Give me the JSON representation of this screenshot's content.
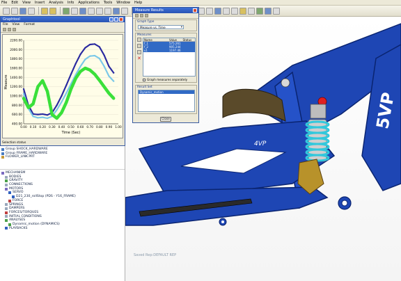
{
  "menubar": {
    "items": [
      "File",
      "Edit",
      "View",
      "Insert",
      "Analysis",
      "Info",
      "Applications",
      "Tools",
      "Window",
      "Help"
    ]
  },
  "graph_window": {
    "title": "Graphtool",
    "menu": [
      "File",
      "View",
      "Format"
    ],
    "status": "Selection status"
  },
  "chart_data": {
    "type": "line",
    "xlabel": "Time (Sec)",
    "ylabel": "Measure",
    "x_ticks": [
      "0.00",
      "0.10",
      "0.20",
      "0.30",
      "0.40",
      "0.50",
      "0.60",
      "0.70",
      "0.80",
      "0.90",
      "1.00"
    ],
    "y_ticks": [
      "400.00",
      "600.00",
      "800.00",
      "1000.00",
      "1200.00",
      "1400.00",
      "1600.00",
      "1800.00",
      "2000.00",
      "2200.00"
    ],
    "xlim": [
      0.0,
      1.0
    ],
    "ylim": [
      400,
      2200
    ],
    "series": [
      {
        "color": "#2a2aa0",
        "values": [
          [
            0.0,
            1150
          ],
          [
            0.05,
            800
          ],
          [
            0.1,
            610
          ],
          [
            0.15,
            600
          ],
          [
            0.2,
            610
          ],
          [
            0.25,
            590
          ],
          [
            0.3,
            640
          ],
          [
            0.35,
            800
          ],
          [
            0.4,
            1000
          ],
          [
            0.45,
            1230
          ],
          [
            0.5,
            1470
          ],
          [
            0.55,
            1700
          ],
          [
            0.6,
            1900
          ],
          [
            0.65,
            2040
          ],
          [
            0.7,
            2110
          ],
          [
            0.75,
            2120
          ],
          [
            0.8,
            2060
          ],
          [
            0.85,
            1880
          ],
          [
            0.9,
            1640
          ],
          [
            0.95,
            1500
          ]
        ]
      },
      {
        "color": "#7ac8e8",
        "values": [
          [
            0.0,
            1050
          ],
          [
            0.05,
            730
          ],
          [
            0.1,
            560
          ],
          [
            0.15,
            530
          ],
          [
            0.2,
            540
          ],
          [
            0.25,
            520
          ],
          [
            0.3,
            560
          ],
          [
            0.35,
            700
          ],
          [
            0.4,
            870
          ],
          [
            0.45,
            1060
          ],
          [
            0.5,
            1260
          ],
          [
            0.55,
            1460
          ],
          [
            0.6,
            1640
          ],
          [
            0.65,
            1790
          ],
          [
            0.7,
            1860
          ],
          [
            0.75,
            1870
          ],
          [
            0.8,
            1810
          ],
          [
            0.85,
            1640
          ],
          [
            0.9,
            1430
          ],
          [
            0.95,
            1320
          ]
        ]
      },
      {
        "color": "#3ae03a",
        "values": [
          [
            0.0,
            950
          ],
          [
            0.05,
            750
          ],
          [
            0.1,
            830
          ],
          [
            0.15,
            1200
          ],
          [
            0.2,
            1330
          ],
          [
            0.25,
            1100
          ],
          [
            0.3,
            600
          ],
          [
            0.35,
            520
          ],
          [
            0.4,
            640
          ],
          [
            0.45,
            860
          ],
          [
            0.5,
            1150
          ],
          [
            0.55,
            1380
          ],
          [
            0.6,
            1530
          ],
          [
            0.65,
            1600
          ],
          [
            0.7,
            1560
          ],
          [
            0.75,
            1470
          ],
          [
            0.8,
            1340
          ],
          [
            0.85,
            1200
          ],
          [
            0.9,
            1060
          ],
          [
            0.95,
            950
          ]
        ]
      }
    ]
  },
  "measure_dialog": {
    "title": "Measure Results",
    "graph_type_label": "Graph Type",
    "graph_type_value": "Measure vs. Time",
    "measures_label": "Measures",
    "columns": [
      "Name",
      "Value",
      "Status"
    ],
    "rows": [
      {
        "name": "f_1",
        "value": "575.261",
        "status": ""
      },
      {
        "name": "f_2",
        "value": "905.244",
        "status": ""
      },
      {
        "name": "v1",
        "value": "1197.46",
        "status": ""
      }
    ],
    "separate_checkbox": "Graph measures separately",
    "result_set_label": "Result Set",
    "result_set_item": "Dynamic_motion",
    "close_label": "Close"
  },
  "tree": {
    "top_rows": [
      {
        "label": "Group SHOCK_HARDWARE",
        "icon": "group-icon"
      },
      {
        "label": "Group FRAME_HARDWARE",
        "icon": "group-icon"
      },
      {
        "label": "FLOWER_LINK.PRT",
        "icon": "part-icon"
      }
    ],
    "rows": [
      {
        "label": "MECHANISM",
        "indent": 0,
        "icon": "mechanism-icon"
      },
      {
        "label": "BODIES",
        "indent": 1,
        "icon": "bodies-icon"
      },
      {
        "label": "GRAVITY",
        "indent": 1,
        "icon": "gravity-icon"
      },
      {
        "label": "CONNECTIONS",
        "indent": 1,
        "icon": "connections-icon"
      },
      {
        "label": "MOTORS",
        "indent": 1,
        "icon": "motors-icon"
      },
      {
        "label": "SERVO",
        "indent": 2,
        "icon": "servo-icon"
      },
      {
        "label": "D21_230_rollStop (PDS - Y16_FRAME)",
        "indent": 3,
        "icon": "motor-icon"
      },
      {
        "label": "FORCE",
        "indent": 2,
        "icon": "force-icon"
      },
      {
        "label": "SPRINGS",
        "indent": 1,
        "icon": "springs-icon"
      },
      {
        "label": "DAMPERS",
        "indent": 1,
        "icon": "dampers-icon"
      },
      {
        "label": "FORCES/TORQUES",
        "indent": 1,
        "icon": "forces-icon"
      },
      {
        "label": "INITIAL CONDITIONS",
        "indent": 1,
        "icon": "initial-icon"
      },
      {
        "label": "ANALYSES",
        "indent": 1,
        "icon": "analyses-icon"
      },
      {
        "label": "Dynamic_motion (DYNAMICS)",
        "indent": 2,
        "icon": "analysis-icon"
      },
      {
        "label": "PLAYBACKS",
        "indent": 1,
        "icon": "playbacks-icon"
      }
    ]
  },
  "viewport": {
    "view_label": "Saved Rep:DEFAULT REP",
    "frame_color": "#1e46b4",
    "spring_color": "#32c8dc",
    "frame_text": "5VP"
  }
}
